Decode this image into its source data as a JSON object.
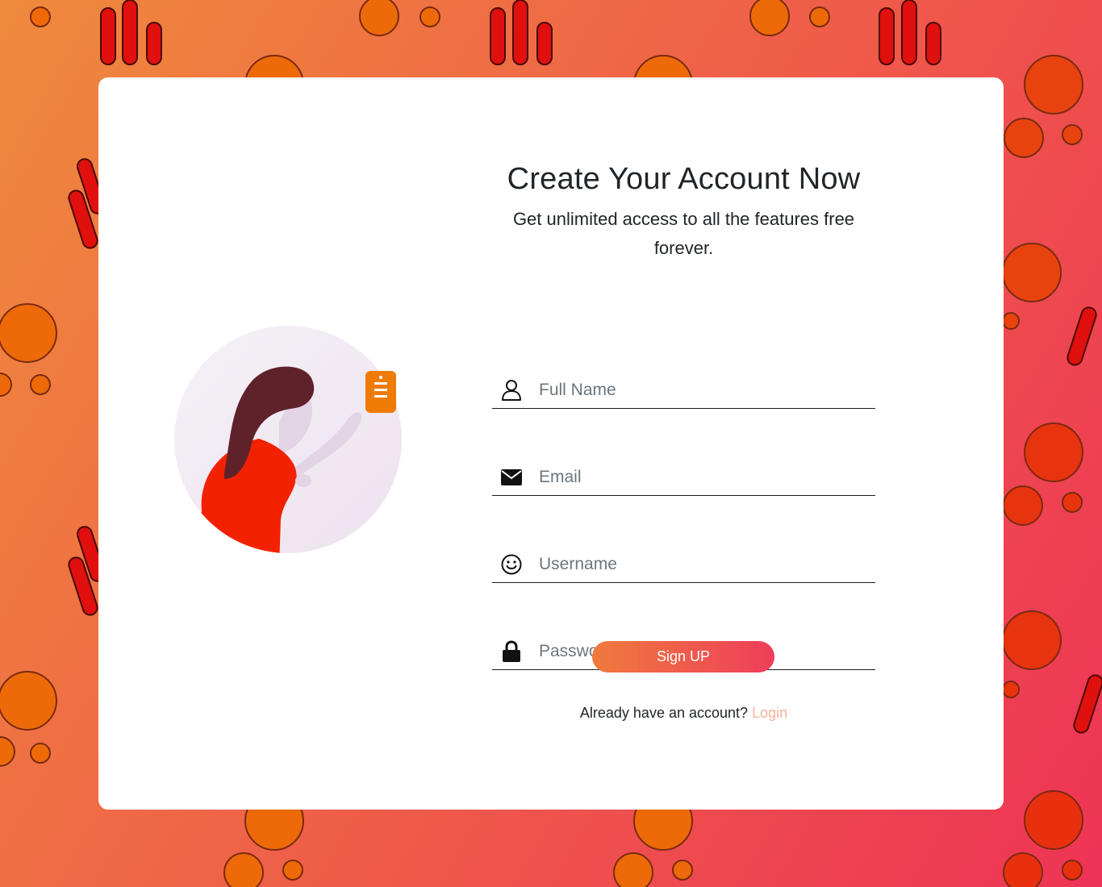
{
  "signup": {
    "title": "Create Your Account Now",
    "subtitle": "Get unlimited access to all the features free forever.",
    "fields": [
      {
        "icon": "user-icon",
        "placeholder": "Full Name",
        "value": ""
      },
      {
        "icon": "envelope-icon",
        "placeholder": "Email",
        "value": ""
      },
      {
        "icon": "smiley-icon",
        "placeholder": "Username",
        "value": ""
      },
      {
        "icon": "lock-icon",
        "placeholder": "Password",
        "value": ""
      }
    ],
    "submit_label": "Sign UP",
    "account_prompt": "Already have an account?",
    "login_link": "Login"
  },
  "colors": {
    "background_start": "#ef8a3c",
    "background_end": "#ee3356",
    "button_start": "#ef7a3d",
    "button_end": "#ef3e5a",
    "login_link": "#f5b097",
    "badge": "#ef7b07"
  }
}
